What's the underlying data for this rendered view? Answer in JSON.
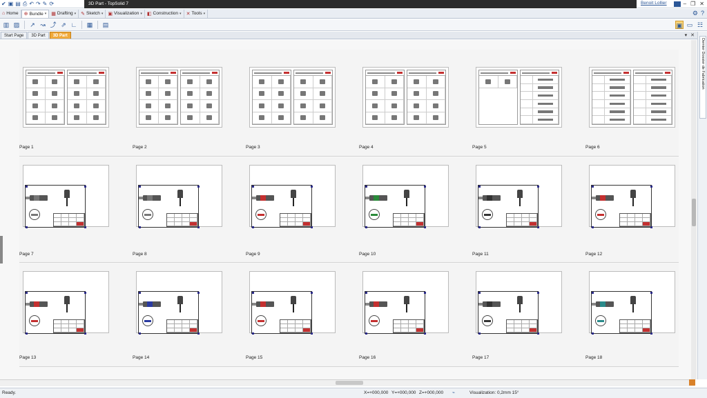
{
  "window": {
    "title": "3D Part - TopSolid 7",
    "user": "Benoit Lollier"
  },
  "tabs": [
    {
      "label": "Home",
      "icon": "home-icon"
    },
    {
      "label": "Bundle",
      "icon": "bundle-icon"
    },
    {
      "label": "Drafting",
      "icon": "drafting-icon"
    },
    {
      "label": "Sketch",
      "icon": "sketch-icon"
    },
    {
      "label": "Visualization",
      "icon": "visualization-icon"
    },
    {
      "label": "Construction",
      "icon": "construction-icon"
    },
    {
      "label": "Tools",
      "icon": "tools-icon"
    }
  ],
  "doc_tabs": [
    {
      "label": "Start Page"
    },
    {
      "label": "3D Part"
    },
    {
      "label": "3D Part",
      "active": true
    }
  ],
  "side_panel": {
    "label": "Dernier Dossier de Fabrication"
  },
  "pages": [
    {
      "label": "Page 1"
    },
    {
      "label": "Page 2"
    },
    {
      "label": "Page 3"
    },
    {
      "label": "Page 4"
    },
    {
      "label": "Page 5"
    },
    {
      "label": "Page 6"
    },
    {
      "label": "Page 7"
    },
    {
      "label": "Page 8"
    },
    {
      "label": "Page 9"
    },
    {
      "label": "Page 10"
    },
    {
      "label": "Page 11"
    },
    {
      "label": "Page 12"
    },
    {
      "label": "Page 13"
    },
    {
      "label": "Page 14"
    },
    {
      "label": "Page 15"
    },
    {
      "label": "Page 16"
    },
    {
      "label": "Page 17"
    },
    {
      "label": "Page 18"
    }
  ],
  "status": {
    "text": "Ready.",
    "x": "X=+000,000",
    "y": "Y=+000,000",
    "z": "Z=+000,000",
    "visualization": "Visualization: 0,2mm 15°"
  },
  "colors": {
    "accent": "#f0a93a",
    "titlebar": "#2d2d2d",
    "brand_blue": "#2b5797",
    "cutter_colors": [
      "#777777",
      "#777777",
      "#c43030",
      "#2a8a3a",
      "#333333",
      "#c43030",
      "#c43030",
      "#2a3aa0",
      "#c43030",
      "#c43030",
      "#333333",
      "#2a8a8a"
    ]
  }
}
